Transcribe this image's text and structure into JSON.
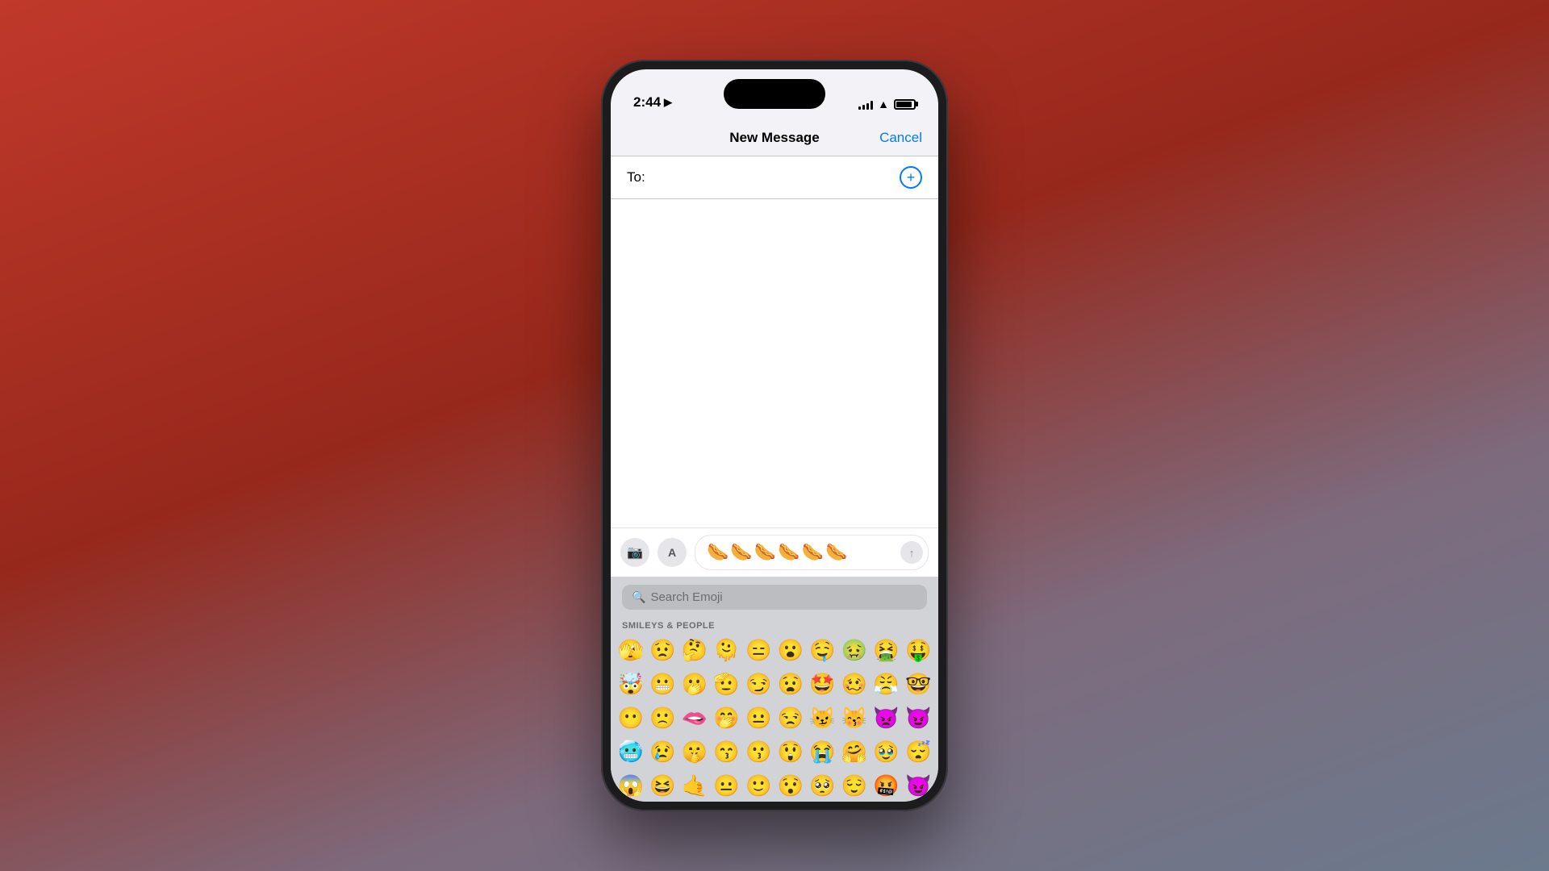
{
  "background": {
    "gradient_start": "#c0392b",
    "gradient_end": "#6b7a8d"
  },
  "status_bar": {
    "time": "2:44",
    "location_icon": "▶",
    "signal_bars": [
      4,
      6,
      8,
      11,
      13
    ],
    "wifi": "wifi",
    "battery_level": 90
  },
  "nav": {
    "title": "New Message",
    "cancel_label": "Cancel"
  },
  "to_field": {
    "label": "To:",
    "placeholder": "",
    "value": ""
  },
  "message_input": {
    "emoji_content": "🌭🌭🌭🌭🌭🌭",
    "send_icon": "↑"
  },
  "toolbar": {
    "camera_icon": "📷",
    "apps_icon": "A"
  },
  "emoji_keyboard": {
    "search_placeholder": "Search Emoji",
    "section_label": "SMILEYS & PEOPLE",
    "emojis_row1": [
      "🫣",
      "😟",
      "🤔",
      "🫠",
      "😑",
      "😮",
      "🤤",
      "🤢",
      "🤮",
      "🤑"
    ],
    "emojis_row2": [
      "🤯",
      "😬",
      "🫢",
      "🫡",
      "😏",
      "😧",
      "🤩",
      "🥴",
      "😤",
      "🤓"
    ],
    "emojis_row3": [
      "😶",
      "🙁",
      "🫦",
      "🤭",
      "😐",
      "😒",
      "😼",
      "😽",
      "👿",
      ""
    ],
    "emojis_row4": [
      "🥶",
      "😢",
      "🤫",
      "😙",
      "😗",
      "😲",
      "😭",
      "🤗",
      "🥹",
      ""
    ],
    "emojis_row5": [
      "😱",
      "😆",
      "🤙",
      "😐",
      "🙂",
      "😯",
      "🥺",
      "😌",
      "🤬",
      "😈"
    ]
  }
}
